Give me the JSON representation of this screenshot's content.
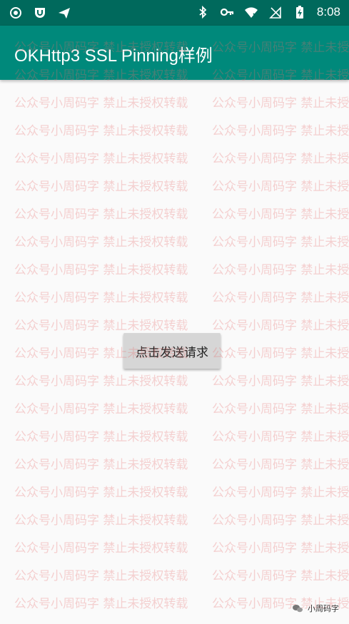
{
  "status_bar": {
    "time": "8:08",
    "left_icons": [
      "record-icon",
      "shield-icon",
      "send-icon"
    ],
    "right_icons": [
      "bluetooth-icon",
      "key-icon",
      "wifi-icon",
      "signal-icon",
      "battery-charging-icon"
    ]
  },
  "app_bar": {
    "title": "OKHttp3 SSL Pinning样例",
    "color": "#00897b",
    "status_color": "#00695c"
  },
  "main": {
    "send_button_label": "点击发送请求"
  },
  "watermark": {
    "text": "公众号小周码字 禁止未授权转载"
  },
  "brand": {
    "name": "小周码字"
  }
}
